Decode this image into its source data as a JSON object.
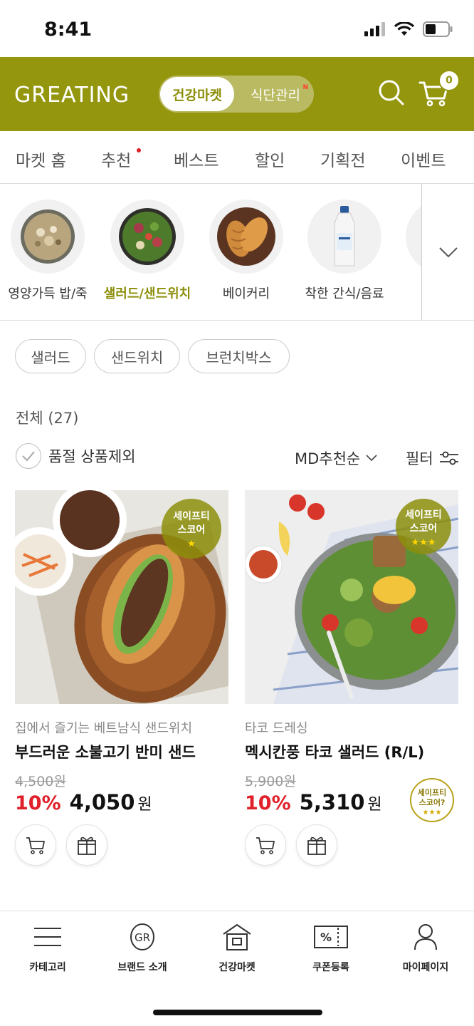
{
  "status_bar": {
    "time": "8:41"
  },
  "header": {
    "logo": "GREATING",
    "segment_active": "건강마켓",
    "segment_inactive": "식단관리",
    "segment_new": "N",
    "cart_count": "0"
  },
  "nav": {
    "tabs": [
      {
        "label": "마켓 홈"
      },
      {
        "label": "추천"
      },
      {
        "label": "베스트"
      },
      {
        "label": "할인"
      },
      {
        "label": "기획전"
      },
      {
        "label": "이벤트"
      }
    ]
  },
  "categories": [
    {
      "label": "영양가득 밥/죽"
    },
    {
      "label": "샐러드/샌드위치"
    },
    {
      "label": "베이커리"
    },
    {
      "label": "착한 간식/음료"
    }
  ],
  "chips": [
    {
      "label": "샐러드"
    },
    {
      "label": "샌드위치"
    },
    {
      "label": "브런치박스"
    }
  ],
  "listing": {
    "count_text": "전체 (27)",
    "exclude_soldout": "품절 상품제외",
    "sort": "MD추천순",
    "filter": "필터"
  },
  "products": [
    {
      "badge_line1": "세이프티",
      "badge_line2": "스코어",
      "badge_stars": "★",
      "desc": "집에서 즐기는 베트남식 샌드위치",
      "name": "부드러운 소불고기 반미 샌드",
      "orig_price": "4,500원",
      "discount": "10%",
      "price": "4,050",
      "won": "원"
    },
    {
      "badge_line1": "세이프티",
      "badge_line2": "스코어",
      "badge_stars": "★★★",
      "desc": "타코 드레싱",
      "name": "멕시칸풍 타코 샐러드 (R/L)",
      "orig_price": "5,900원",
      "discount": "10%",
      "price": "5,310",
      "won": "원"
    }
  ],
  "stamp": {
    "line1": "세이프티",
    "line2": "스코어?",
    "stars": "★★★"
  },
  "bottom_nav": [
    {
      "label": "카테고리"
    },
    {
      "label": "브랜드 소개"
    },
    {
      "label": "건강마켓"
    },
    {
      "label": "쿠폰등록"
    },
    {
      "label": "마이페이지"
    }
  ]
}
